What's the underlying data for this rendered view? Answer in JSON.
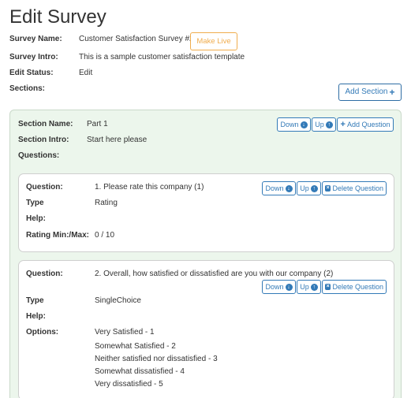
{
  "page": {
    "title": "Edit Survey"
  },
  "survey": {
    "name_label": "Survey Name:",
    "name_value": "Customer Satisfaction Survey #2",
    "make_live_label": "Make Live",
    "intro_label": "Survey Intro:",
    "intro_value": "This is a sample customer satisfaction template",
    "status_label": "Edit Status:",
    "status_value": "Edit",
    "sections_label": "Sections:",
    "add_section_label": "Add Section"
  },
  "section": {
    "name_label": "Section Name:",
    "name_value": "Part 1",
    "intro_label": "Section Intro:",
    "intro_value": "Start here please",
    "questions_label": "Questions:",
    "down_label": "Down",
    "up_label": "Up",
    "add_question_label": "Add Question"
  },
  "questions": [
    {
      "question_label": "Question:",
      "question_value": "1. Please rate this company (1)",
      "type_label": "Type",
      "type_value": "Rating",
      "help_label": "Help:",
      "help_value": "",
      "range_label": "Rating Min:/Max:",
      "range_value": "0 / 10",
      "down_label": "Down",
      "up_label": "Up",
      "delete_label": "Delete Question"
    },
    {
      "question_label": "Question:",
      "question_value": "2. Overall, how satisfied or dissatisfied are you with our company (2)",
      "type_label": "Type",
      "type_value": "SingleChoice",
      "help_label": "Help:",
      "help_value": "",
      "options_label": "Options:",
      "options": [
        "Very Satisfied - 1",
        "Somewhat Satisfied - 2",
        "Neither satisfied nor dissatisfied - 3",
        "Somewhat dissatisfied - 4",
        "Very dissatisfied - 5"
      ],
      "down_label": "Down",
      "up_label": "Up",
      "delete_label": "Delete Question"
    }
  ],
  "icons": {
    "down": "arrow-down-circle-icon",
    "up": "arrow-up-circle-icon",
    "plus": "plus-icon",
    "delete": "delete-icon"
  },
  "colors": {
    "primary": "#337ab7",
    "warning": "#f0ad4e",
    "section_bg": "#ecf6ec",
    "text": "#333333"
  }
}
